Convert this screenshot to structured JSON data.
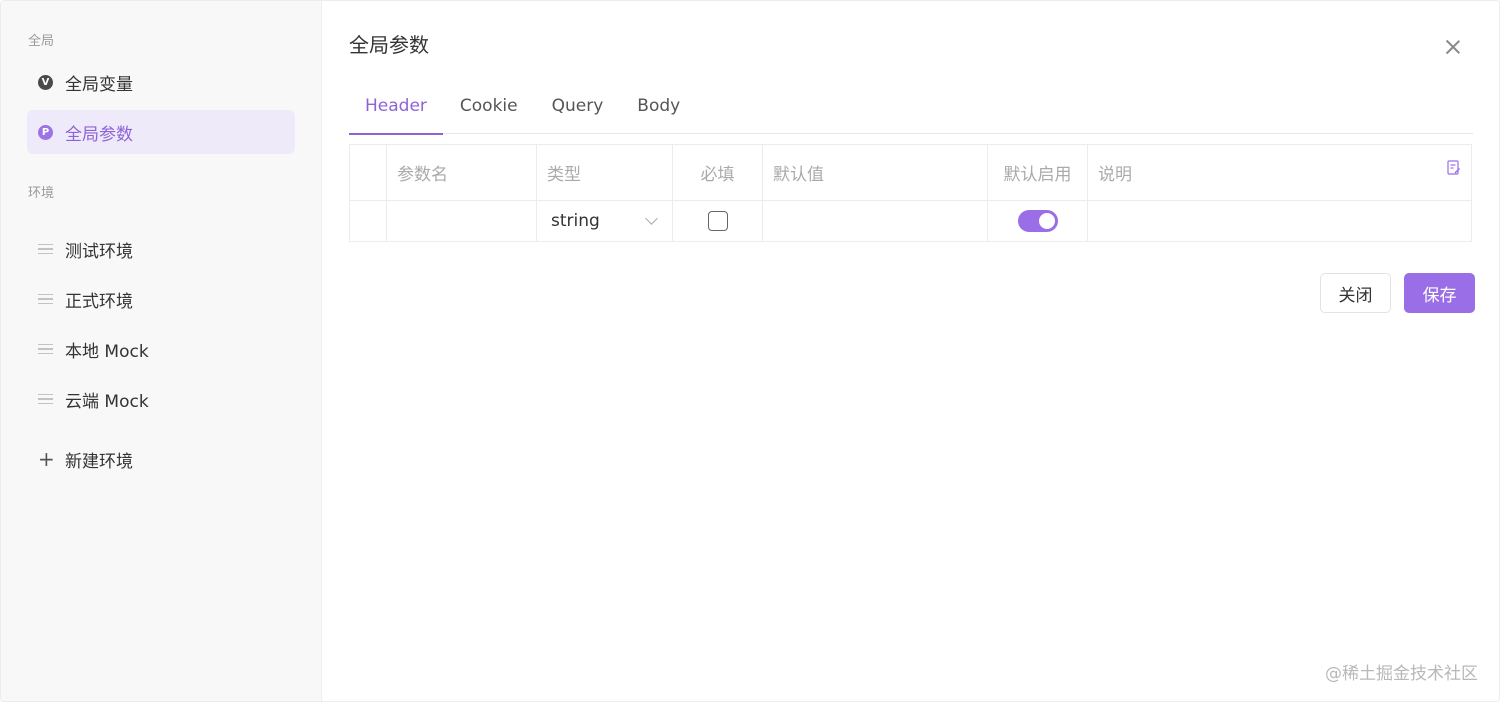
{
  "sidebar": {
    "global_section": "全局",
    "global_items": [
      {
        "badge": "V",
        "label": "全局变量"
      },
      {
        "badge": "P",
        "label": "全局参数"
      }
    ],
    "env_section": "环境",
    "env_items": [
      {
        "label": "测试环境"
      },
      {
        "label": "正式环境"
      },
      {
        "label": "本地 Mock"
      },
      {
        "label": "云端 Mock"
      }
    ],
    "new_env_label": "新建环境"
  },
  "main": {
    "title": "全局参数",
    "tabs": [
      "Header",
      "Cookie",
      "Query",
      "Body"
    ],
    "active_tab": "Header",
    "table": {
      "headers": [
        "",
        "参数名",
        "类型",
        "必填",
        "默认值",
        "默认启用",
        "说明"
      ],
      "row": {
        "type": "string",
        "required": false,
        "default_enabled": true
      }
    },
    "buttons": {
      "close": "关闭",
      "save": "保存"
    }
  },
  "watermark": "@稀土掘金技术社区",
  "colors": {
    "accent": "#9a6ee6",
    "active_bg": "#efeaf9"
  }
}
